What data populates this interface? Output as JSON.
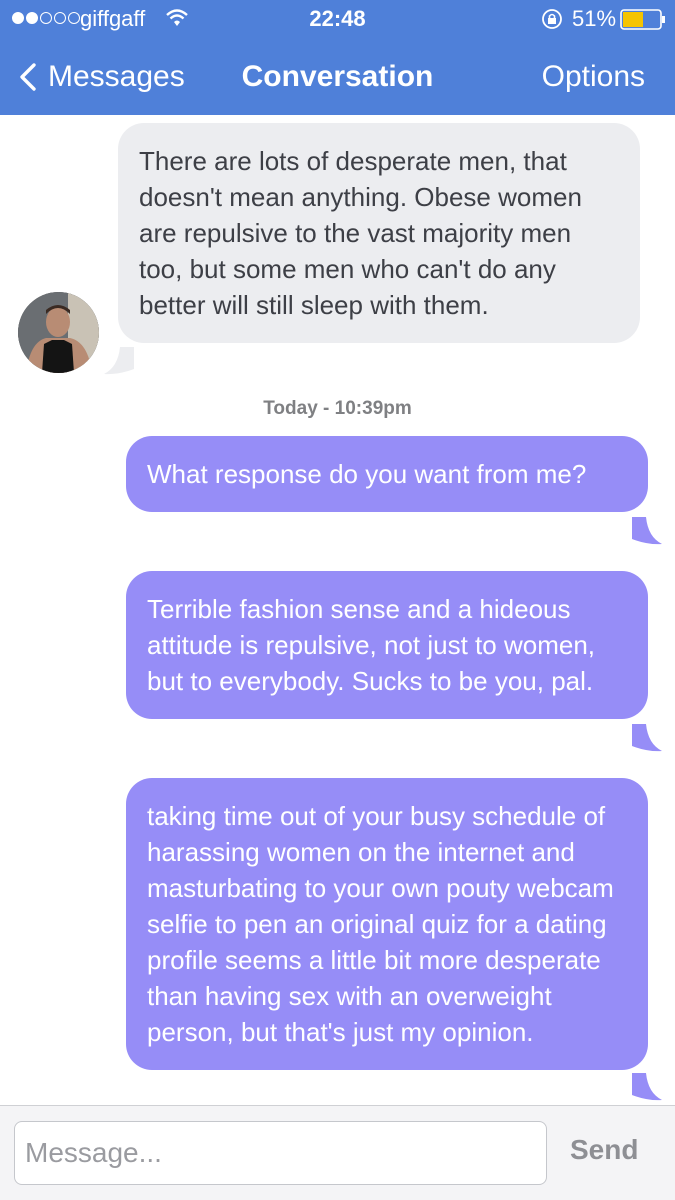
{
  "status_bar": {
    "carrier": "giffgaff",
    "time": "22:48",
    "battery": "51%"
  },
  "nav": {
    "back_label": "Messages",
    "title": "Conversation",
    "options_label": "Options"
  },
  "conversation": {
    "timestamp": "Today - 10:39pm",
    "messages": [
      {
        "direction": "incoming",
        "text": "There are lots of desperate men, that doesn't mean anything. Obese women are repulsive to the vast majority men too, but some men who can't do any better will still sleep with them."
      },
      {
        "direction": "outgoing",
        "text": "What response do you want from me?"
      },
      {
        "direction": "outgoing",
        "text": "Terrible fashion sense and a hideous attitude is repulsive, not just to women, but to everybody. Sucks to be you, pal."
      },
      {
        "direction": "outgoing",
        "text": "taking time out of your busy schedule of harassing women on the internet and masturbating to your own pouty webcam selfie to pen an original quiz for a dating profile seems a little bit more desperate than having sex with an overweight person, but that's just my opinion."
      }
    ]
  },
  "composer": {
    "placeholder": "Message...",
    "send_label": "Send"
  },
  "colors": {
    "header": "#4f80d9",
    "incoming_bubble": "#ecedf0",
    "outgoing_bubble": "#968df7",
    "battery_fill": "#f5c400"
  }
}
